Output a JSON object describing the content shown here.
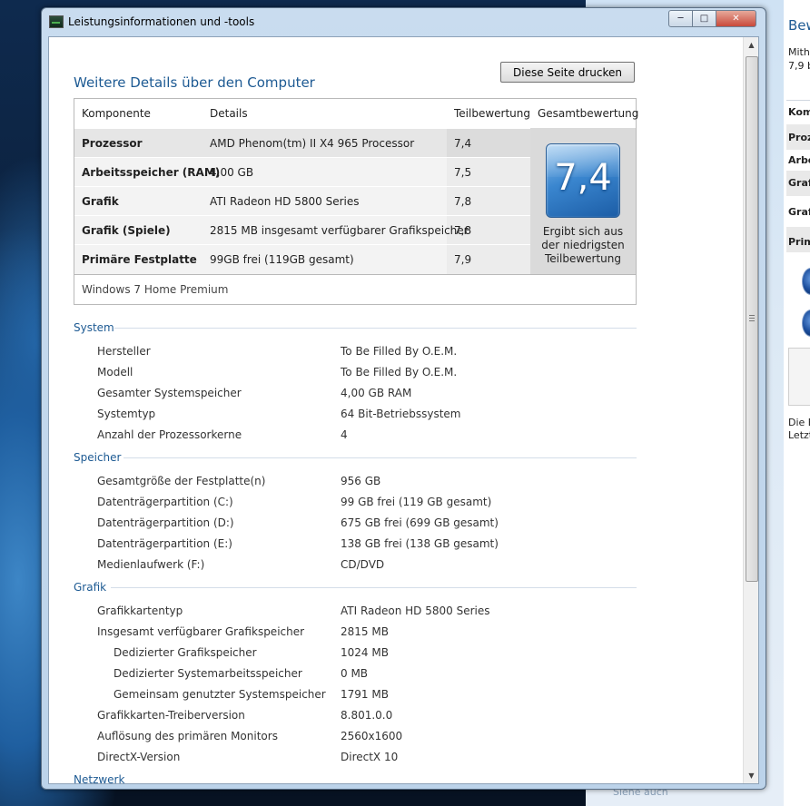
{
  "window": {
    "title": "Leistungsinformationen und -tools",
    "heading": "Weitere Details über den Computer",
    "print_label": "Diese Seite drucken"
  },
  "score_table": {
    "headers": [
      "Komponente",
      "Details",
      "Teilbewertung",
      "Gesamtbewertung"
    ],
    "rows": [
      {
        "component": "Prozessor",
        "details": "AMD Phenom(tm) II X4 965 Processor",
        "score": "7,4"
      },
      {
        "component": "Arbeitsspeicher (RAM)",
        "details": "4,00 GB",
        "score": "7,5"
      },
      {
        "component": "Grafik",
        "details": "ATI Radeon HD 5800 Series",
        "score": "7,8"
      },
      {
        "component": "Grafik (Spiele)",
        "details": "2815 MB insgesamt verfügbarer Grafikspeicher",
        "score": "7,8"
      },
      {
        "component": "Primäre Festplatte",
        "details": "99GB frei (119GB gesamt)",
        "score": "7,9"
      }
    ],
    "base_score": "7,4",
    "base_score_note_1": "Ergibt sich aus",
    "base_score_note_2": "der niedrigsten",
    "base_score_note_3": "Teilbewertung",
    "os": "Windows 7 Home Premium"
  },
  "sections": {
    "system": {
      "title": "System",
      "rows": [
        {
          "label": "Hersteller",
          "value": "To Be Filled By O.E.M."
        },
        {
          "label": "Modell",
          "value": "To Be Filled By O.E.M."
        },
        {
          "label": "Gesamter Systemspeicher",
          "value": "4,00 GB RAM"
        },
        {
          "label": "Systemtyp",
          "value": "64 Bit-Betriebssystem"
        },
        {
          "label": "Anzahl der Prozessorkerne",
          "value": "4"
        }
      ]
    },
    "speicher": {
      "title": "Speicher",
      "rows": [
        {
          "label": "Gesamtgröße der Festplatte(n)",
          "value": "956 GB"
        },
        {
          "label": "Datenträgerpartition (C:)",
          "value": "99 GB frei (119 GB gesamt)"
        },
        {
          "label": "Datenträgerpartition (D:)",
          "value": "675 GB frei (699 GB gesamt)"
        },
        {
          "label": "Datenträgerpartition (E:)",
          "value": "138 GB frei (138 GB gesamt)"
        },
        {
          "label": "Medienlaufwerk (F:)",
          "value": "CD/DVD"
        }
      ]
    },
    "grafik": {
      "title": "Grafik",
      "rows": [
        {
          "label": "Grafikkartentyp",
          "value": "ATI Radeon HD 5800 Series"
        },
        {
          "label": "Insgesamt verfügbarer Grafikspeicher",
          "value": "2815 MB"
        },
        {
          "label": "Dedizierter Grafikspeicher",
          "value": "1024 MB"
        },
        {
          "label": "Dedizierter Systemarbeitsspeicher",
          "value": "0 MB"
        },
        {
          "label": "Gemeinsam genutzter Systemspeicher",
          "value": "1791 MB"
        },
        {
          "label": "Grafikkarten-Treiberversion",
          "value": "8.801.0.0"
        },
        {
          "label": "Auflösung des primären Monitors",
          "value": "2560x1600"
        },
        {
          "label": "DirectX-Version",
          "value": "DirectX 10"
        }
      ]
    },
    "netzwerk": {
      "title": "Netzwerk"
    }
  },
  "background_window": {
    "title": "Bew",
    "line1": "Mith",
    "line2": "7,9 b",
    "header": "Komp",
    "rows": [
      "Proz",
      "Arbe",
      "Graf",
      "Graf",
      "Prim"
    ],
    "footer1": "Die B",
    "footer2": "Letzt",
    "bottom_link": "Siehe auch"
  }
}
